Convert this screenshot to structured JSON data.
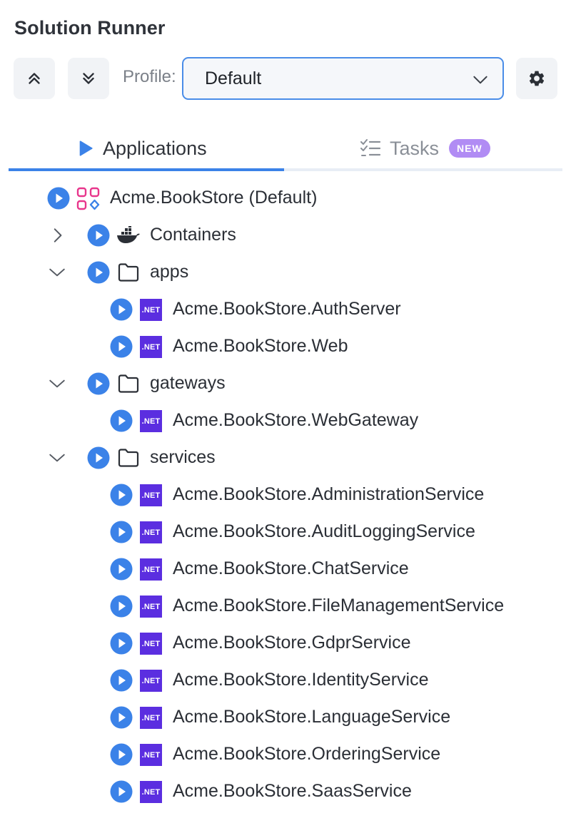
{
  "panel": {
    "title": "Solution Runner"
  },
  "toolbar": {
    "collapse_all_icon": "chevrons-up-icon",
    "expand_all_icon": "chevrons-down-icon",
    "profile_label": "Profile:",
    "profile_value": "Default",
    "settings_icon": "gear-icon"
  },
  "tabs": [
    {
      "label": "Applications",
      "icon": "play-icon",
      "active": true
    },
    {
      "label": "Tasks",
      "icon": "checklist-icon",
      "active": false,
      "badge": "NEW"
    }
  ],
  "tree": {
    "root": {
      "label": "Acme.BookStore (Default)",
      "icon": "solution-grid-icon"
    },
    "containers": {
      "label": "Containers",
      "icon": "docker-icon",
      "expanded": false
    },
    "apps": {
      "label": "apps",
      "icon": "folder-icon",
      "expanded": true,
      "items": [
        {
          "label": "Acme.BookStore.AuthServer",
          "icon_text": ".NET"
        },
        {
          "label": "Acme.BookStore.Web",
          "icon_text": ".NET"
        }
      ]
    },
    "gateways": {
      "label": "gateways",
      "icon": "folder-icon",
      "expanded": true,
      "items": [
        {
          "label": "Acme.BookStore.WebGateway",
          "icon_text": ".NET"
        }
      ]
    },
    "services": {
      "label": "services",
      "icon": "folder-icon",
      "expanded": true,
      "items": [
        {
          "label": "Acme.BookStore.AdministrationService",
          "icon_text": ".NET"
        },
        {
          "label": "Acme.BookStore.AuditLoggingService",
          "icon_text": ".NET"
        },
        {
          "label": "Acme.BookStore.ChatService",
          "icon_text": ".NET"
        },
        {
          "label": "Acme.BookStore.FileManagementService",
          "icon_text": ".NET"
        },
        {
          "label": "Acme.BookStore.GdprService",
          "icon_text": ".NET"
        },
        {
          "label": "Acme.BookStore.IdentityService",
          "icon_text": ".NET"
        },
        {
          "label": "Acme.BookStore.LanguageService",
          "icon_text": ".NET"
        },
        {
          "label": "Acme.BookStore.OrderingService",
          "icon_text": ".NET"
        },
        {
          "label": "Acme.BookStore.SaasService",
          "icon_text": ".NET"
        }
      ]
    }
  },
  "colors": {
    "accent": "#3b82e8",
    "play": "#3b82e8",
    "dotnet": "#5b2ee0",
    "badge": "#b18cf4",
    "solution_icon": "#e8368c"
  }
}
